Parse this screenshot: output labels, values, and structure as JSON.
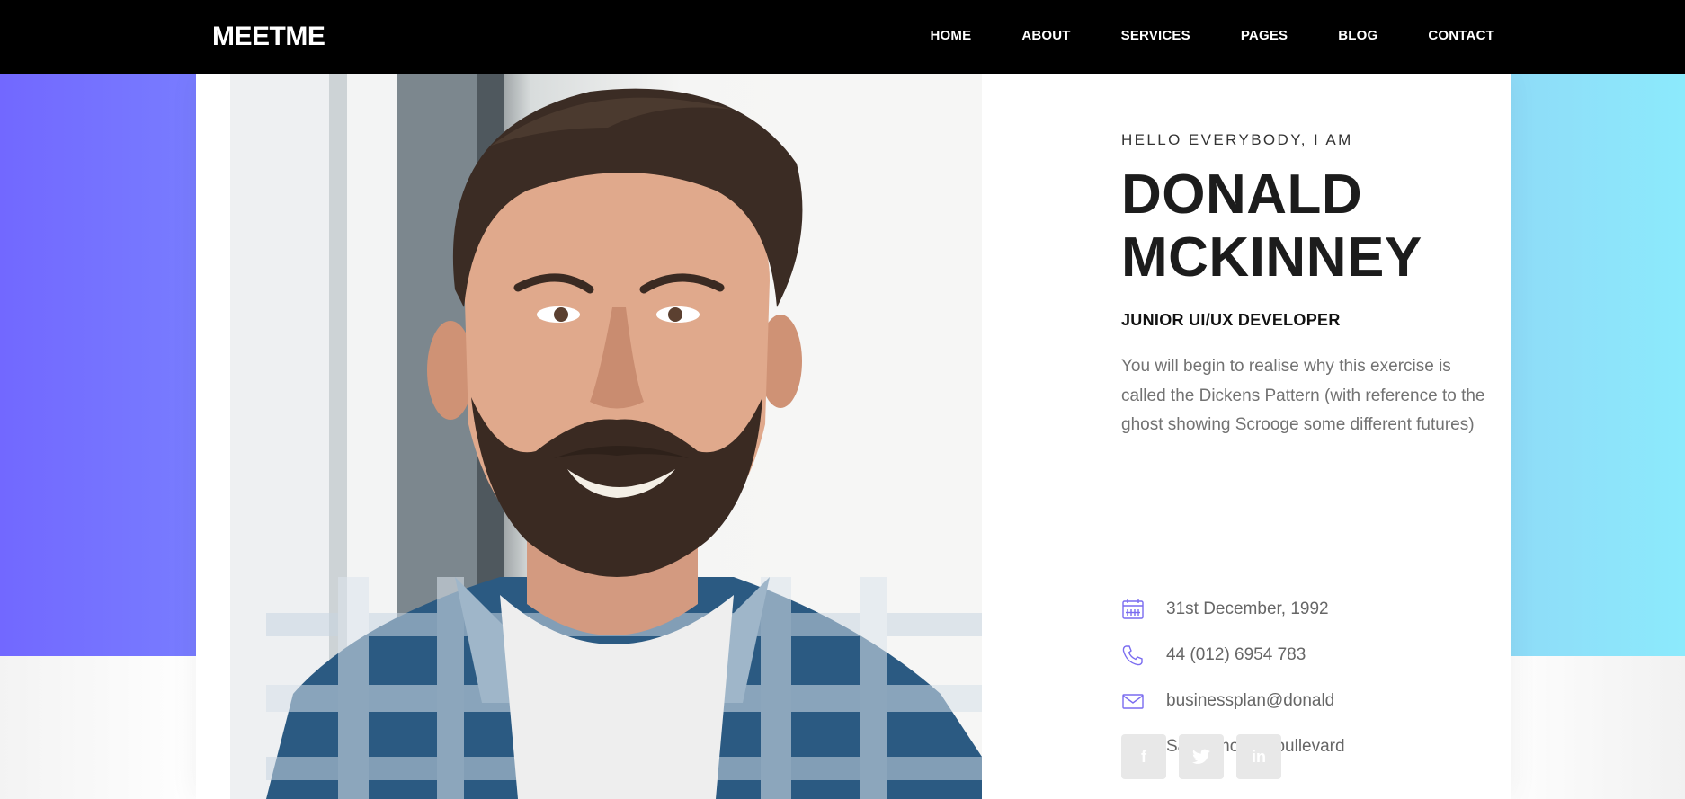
{
  "brand": {
    "logo": "MEETME"
  },
  "nav": {
    "items": [
      {
        "label": "HOME"
      },
      {
        "label": "ABOUT"
      },
      {
        "label": "SERVICES"
      },
      {
        "label": "PAGES"
      },
      {
        "label": "BLOG"
      },
      {
        "label": "CONTACT"
      }
    ]
  },
  "profile": {
    "greeting": "HELLO EVERYBODY, I AM",
    "name_line1": "DONALD",
    "name_line2": "MCKINNEY",
    "role": "JUNIOR UI/UX DEVELOPER",
    "bio": "You will begin to realise why this exercise is called the Dickens Pattern (with reference to the ghost showing Scrooge some different futures)"
  },
  "contact": {
    "birthday": {
      "icon": "calendar-icon",
      "text": "31st December, 1992"
    },
    "phone": {
      "icon": "phone-icon",
      "text": "44 (012) 6954 783"
    },
    "email": {
      "icon": "mail-icon",
      "text": "businessplan@donald"
    },
    "address": {
      "icon": "home-icon",
      "text": "Santa monica bullevard"
    }
  },
  "social": [
    {
      "icon": "facebook-icon",
      "glyph": "f"
    },
    {
      "icon": "twitter-icon",
      "glyph": "t"
    },
    {
      "icon": "linkedin-icon",
      "glyph": "in"
    }
  ],
  "colors": {
    "accent": "#7268ff",
    "gradient_start": "#7268ff",
    "gradient_end": "#8ceafc",
    "nav_bg": "#000000",
    "icon_color": "#7a6cf0"
  }
}
